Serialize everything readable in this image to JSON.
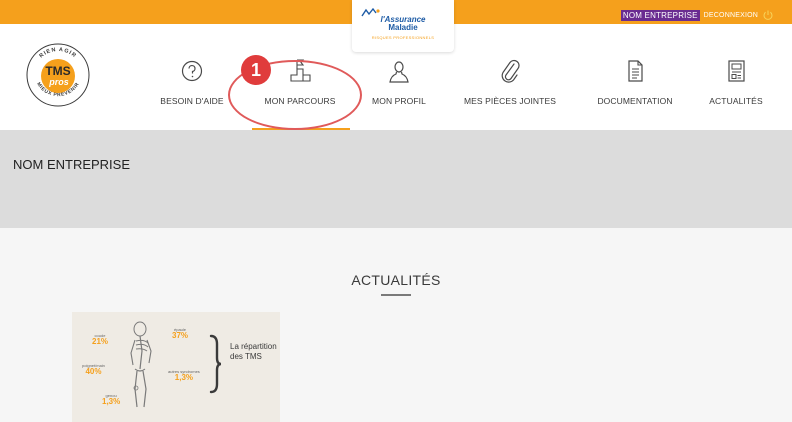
{
  "topbar": {
    "company_tag": "NOM ENTREPRISE",
    "logout_label": "DECONNEXION",
    "bg_color": "#f5a01c"
  },
  "partner_logo": {
    "line1": "l'Assurance",
    "line2": "Maladie",
    "line3": "RISQUES PROFESSIONNELS"
  },
  "brand_logo": {
    "name": "TMS",
    "sub": "pros",
    "ring_text_top": "RIEN AGIR",
    "ring_text_bottom": "MIEUX PRÉVENIR"
  },
  "nav": {
    "items": [
      {
        "label": "BESOIN D'AIDE",
        "icon": "question-circle-icon"
      },
      {
        "label": "MON PARCOURS",
        "icon": "stairs-flag-icon",
        "active": true
      },
      {
        "label": "MON PROFIL",
        "icon": "user-icon"
      },
      {
        "label": "MES PIÈCES JOINTES",
        "icon": "paperclip-icon"
      },
      {
        "label": "DOCUMENTATION",
        "icon": "document-icon"
      },
      {
        "label": "ACTUALITÉS",
        "icon": "newspaper-icon"
      }
    ],
    "active_color": "#f5a01c"
  },
  "annotation": {
    "badge": "1",
    "color": "#e03c3c"
  },
  "header_band": {
    "company_name": "NOM ENTREPRISE"
  },
  "news": {
    "title": "ACTUALITÉS",
    "card": {
      "heading": "La répartition des TMS",
      "stats": [
        {
          "label": "coude",
          "value": "21%"
        },
        {
          "label": "épaule",
          "value": "37%"
        },
        {
          "label": "poignet/main",
          "value": "40%"
        },
        {
          "label": "autres syndromes",
          "value": "1,3%"
        },
        {
          "label": "genou",
          "value": "1,3%"
        }
      ]
    }
  }
}
